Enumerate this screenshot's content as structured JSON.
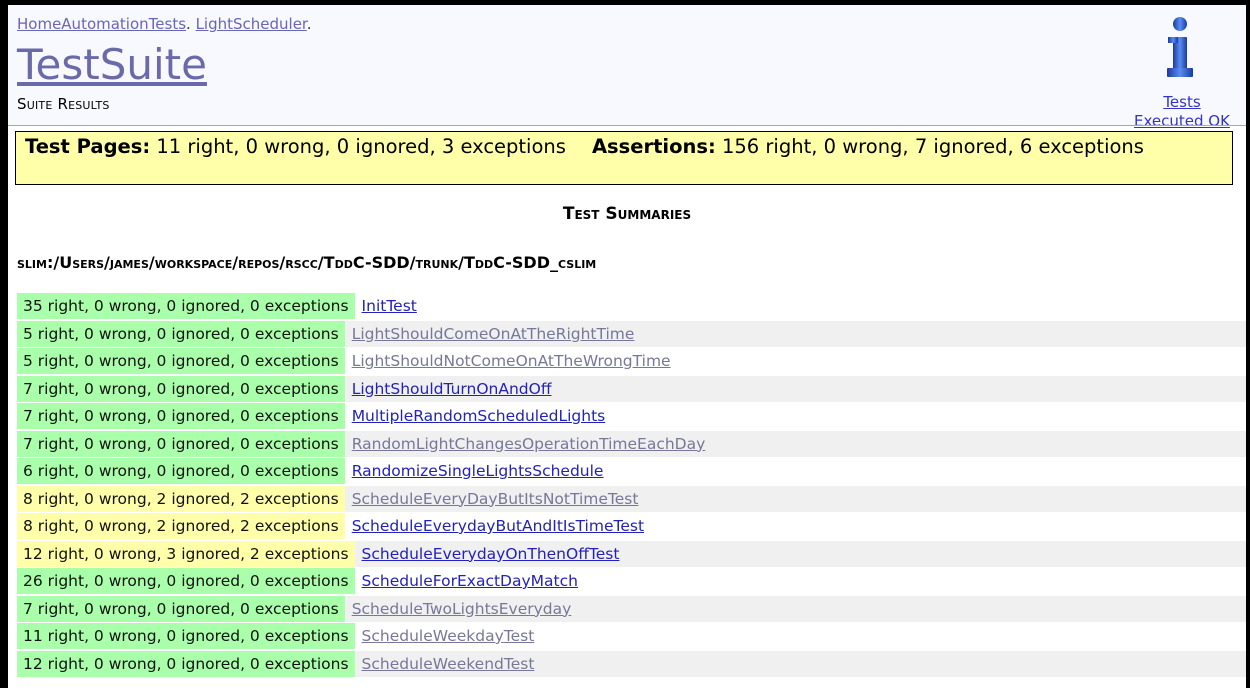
{
  "breadcrumb": {
    "first": "HomeAutomationTests",
    "sep1": ". ",
    "second": "LightScheduler",
    "sep2": "."
  },
  "page_title": "TestSuite",
  "subtitle": "Suite Results",
  "info": {
    "icon": "info-icon",
    "line1": "Tests",
    "line2": "Executed OK"
  },
  "summary": {
    "pages_label": "Test Pages:",
    "pages_text": "11 right, 0 wrong, 0 ignored, 3 exceptions",
    "assertions_label": "Assertions:",
    "assertions_text": "156 right, 0 wrong, 7 ignored, 6 exceptions"
  },
  "section_title": "Test Summaries",
  "path_title": "slim:/Users/james/workspace/repos/rscc/TddC-SDD/trunk/TddC-SDD_cslim",
  "colors": {
    "pass": "#aaffaa",
    "warn": "#ffffaa",
    "visited_link": "#777799",
    "link": "#2222bb"
  },
  "results": [
    {
      "status": "35 right, 0 wrong, 0 ignored, 0 exceptions",
      "test": "InitTest",
      "state": "pass",
      "visited": false
    },
    {
      "status": "5 right, 0 wrong, 0 ignored, 0 exceptions",
      "test": "LightShouldComeOnAtTheRightTime",
      "state": "pass",
      "visited": true
    },
    {
      "status": "5 right, 0 wrong, 0 ignored, 0 exceptions",
      "test": "LightShouldNotComeOnAtTheWrongTime",
      "state": "pass",
      "visited": true
    },
    {
      "status": "7 right, 0 wrong, 0 ignored, 0 exceptions",
      "test": "LightShouldTurnOnAndOff",
      "state": "pass",
      "visited": false
    },
    {
      "status": "7 right, 0 wrong, 0 ignored, 0 exceptions",
      "test": "MultipleRandomScheduledLights",
      "state": "pass",
      "visited": false
    },
    {
      "status": "7 right, 0 wrong, 0 ignored, 0 exceptions",
      "test": "RandomLightChangesOperationTimeEachDay",
      "state": "pass",
      "visited": true
    },
    {
      "status": "6 right, 0 wrong, 0 ignored, 0 exceptions",
      "test": "RandomizeSingleLightsSchedule",
      "state": "pass",
      "visited": false
    },
    {
      "status": "8 right, 0 wrong, 2 ignored, 2 exceptions",
      "test": "ScheduleEveryDayButItsNotTimeTest",
      "state": "warn",
      "visited": true
    },
    {
      "status": "8 right, 0 wrong, 2 ignored, 2 exceptions",
      "test": "ScheduleEverydayButAndItIsTimeTest",
      "state": "warn",
      "visited": false
    },
    {
      "status": "12 right, 0 wrong, 3 ignored, 2 exceptions",
      "test": "ScheduleEverydayOnThenOffTest",
      "state": "warn",
      "visited": false
    },
    {
      "status": "26 right, 0 wrong, 0 ignored, 0 exceptions",
      "test": "ScheduleForExactDayMatch",
      "state": "pass",
      "visited": false
    },
    {
      "status": "7 right, 0 wrong, 0 ignored, 0 exceptions",
      "test": "ScheduleTwoLightsEveryday",
      "state": "pass",
      "visited": true
    },
    {
      "status": "11 right, 0 wrong, 0 ignored, 0 exceptions",
      "test": "ScheduleWeekdayTest",
      "state": "pass",
      "visited": true
    },
    {
      "status": "12 right, 0 wrong, 0 ignored, 0 exceptions",
      "test": "ScheduleWeekendTest",
      "state": "pass",
      "visited": true
    }
  ]
}
